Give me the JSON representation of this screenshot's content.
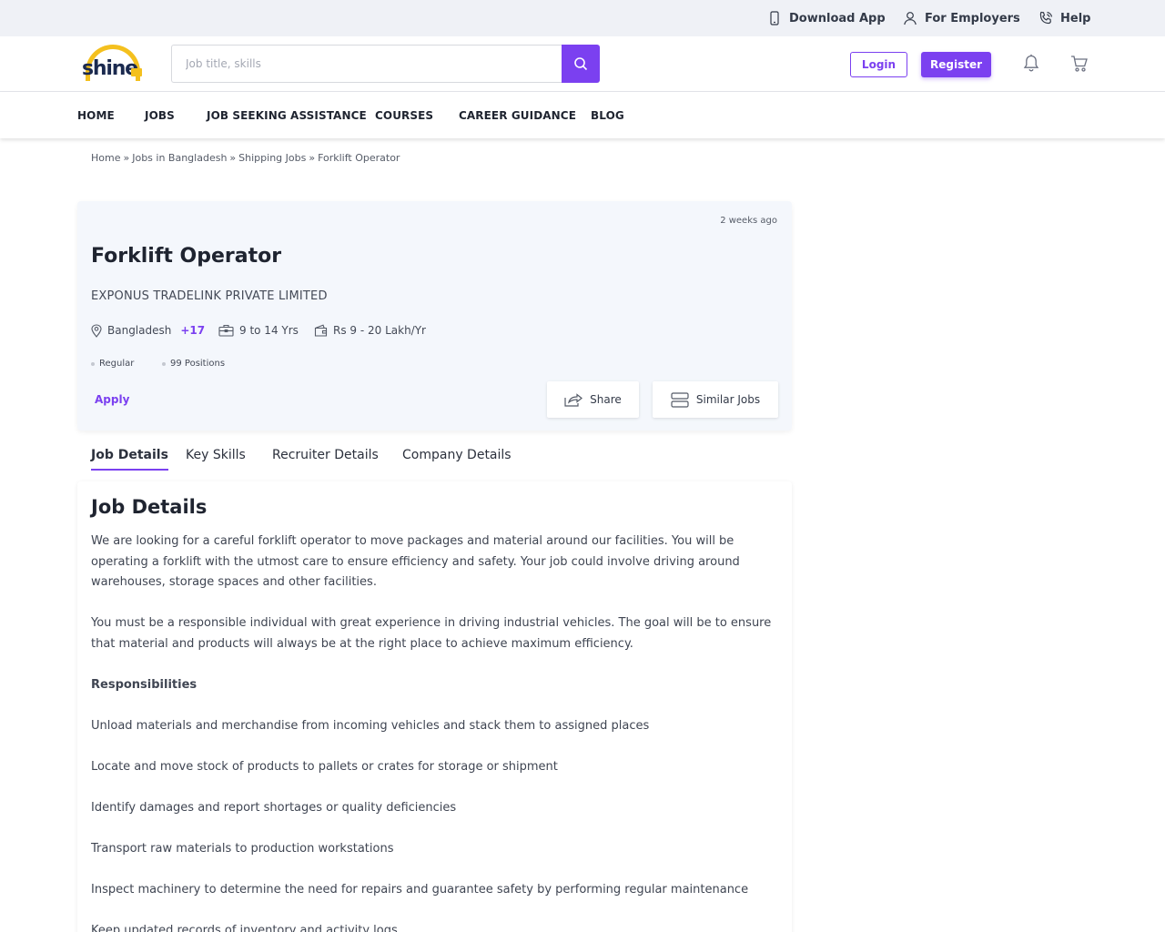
{
  "topbar": {
    "download_app": "Download App",
    "for_employers": "For Employers",
    "help": "Help"
  },
  "header": {
    "logo_text": "shine",
    "search_placeholder": "Job title, skills",
    "search_value": "",
    "login_label": "Login",
    "register_label": "Register"
  },
  "nav": {
    "items": [
      "HOME",
      "JOBS",
      "JOB SEEKING ASSISTANCE",
      "COURSES",
      "CAREER GUIDANCE",
      "BLOG"
    ]
  },
  "breadcrumb": {
    "items": [
      "Home",
      "Jobs in Bangladesh",
      "Shipping Jobs",
      "Forklift Operator"
    ],
    "separator": "»"
  },
  "job": {
    "posted": "2 weeks ago",
    "title": "Forklift Operator",
    "company": "EXPONUS TRADELINK PRIVATE LIMITED",
    "location": "Bangladesh",
    "location_more": "+17",
    "experience": "9 to 14 Yrs",
    "salary": "Rs 9 - 20 Lakh/Yr",
    "tags": [
      "Regular",
      "99 Positions"
    ],
    "apply_label": "Apply",
    "share_label": "Share",
    "similar_label": "Similar Jobs"
  },
  "tabs": [
    "Job Details",
    "Key Skills",
    "Recruiter Details",
    "Company Details"
  ],
  "details": {
    "heading": "Job Details",
    "paragraphs": [
      "We are looking for a careful forklift operator to move packages and material around our facilities. You will be operating a forklift with the utmost care to ensure efficiency and safety. Your job could involve driving around warehouses, storage spaces and other facilities.",
      "You must be a responsible individual with great experience in driving industrial vehicles. The goal will be to ensure that material and products will always be at the right place to achieve maximum efficiency.",
      "Responsibilities",
      "Unload materials and merchandise from incoming vehicles and stack them to assigned places",
      "Locate and move stock of products to pallets or crates for storage or shipment",
      "Identify damages and report shortages or quality deficiencies",
      "Transport raw materials to production workstations",
      "Inspect machinery to determine the need for repairs and guarantee safety by performing regular maintenance",
      "Keep updated records of inventory and activity logs"
    ]
  },
  "colors": {
    "accent": "#7b40f0",
    "logo_yellow": "#f4c01e",
    "logo_navy": "#1b2a4f",
    "topbar_bg": "#eff1f6",
    "card_bg": "#f4f7fc"
  },
  "icons": {
    "download_app": "mobile-phone-icon",
    "for_employers": "user-icon",
    "help": "phone-call-icon",
    "search": "search-icon",
    "notifications": "bell-icon",
    "cart": "cart-icon",
    "location": "map-pin-icon",
    "experience": "briefcase-icon",
    "salary": "wallet-icon",
    "share": "share-icon",
    "similar": "list-icon"
  }
}
